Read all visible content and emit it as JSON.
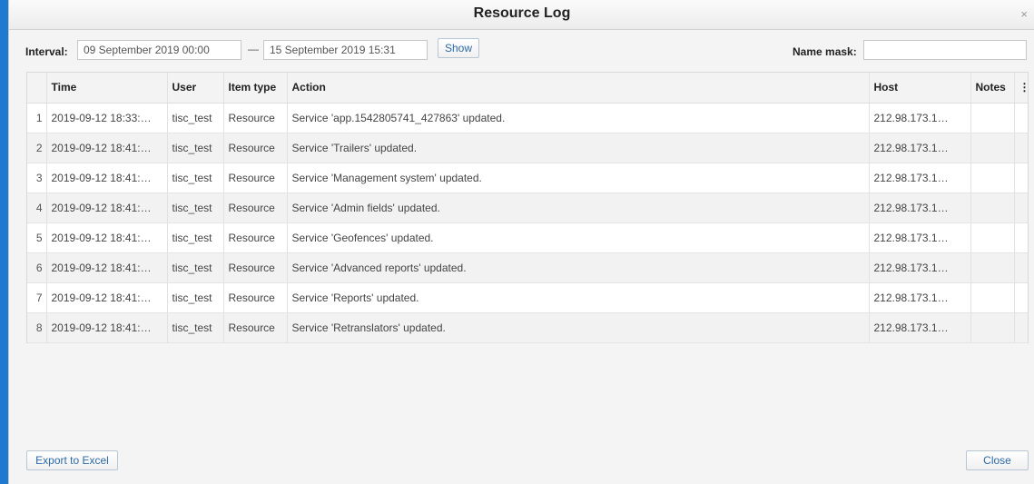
{
  "dialog": {
    "title": "Resource Log",
    "close_icon": "close-icon",
    "close_glyph": "×"
  },
  "filter": {
    "interval_label": "Interval:",
    "from_value": "09 September 2019 00:00",
    "separator": "—",
    "to_value": "15 September 2019 15:31",
    "show_label": "Show",
    "name_mask_label": "Name mask:",
    "name_mask_value": ""
  },
  "table": {
    "columns": {
      "time": "Time",
      "user": "User",
      "item_type": "Item type",
      "action": "Action",
      "host": "Host",
      "notes": "Notes",
      "menu_glyph": "⋮"
    },
    "rows": [
      {
        "num": "1",
        "time": "2019-09-12 18:33:…",
        "user": "tisc_test",
        "item_type": "Resource",
        "action": "Service 'app.1542805741_427863' updated.",
        "host": "212.98.173.1…",
        "notes": ""
      },
      {
        "num": "2",
        "time": "2019-09-12 18:41:…",
        "user": "tisc_test",
        "item_type": "Resource",
        "action": "Service 'Trailers' updated.",
        "host": "212.98.173.1…",
        "notes": ""
      },
      {
        "num": "3",
        "time": "2019-09-12 18:41:…",
        "user": "tisc_test",
        "item_type": "Resource",
        "action": "Service 'Management system' updated.",
        "host": "212.98.173.1…",
        "notes": ""
      },
      {
        "num": "4",
        "time": "2019-09-12 18:41:…",
        "user": "tisc_test",
        "item_type": "Resource",
        "action": "Service 'Admin fields' updated.",
        "host": "212.98.173.1…",
        "notes": ""
      },
      {
        "num": "5",
        "time": "2019-09-12 18:41:…",
        "user": "tisc_test",
        "item_type": "Resource",
        "action": "Service 'Geofences' updated.",
        "host": "212.98.173.1…",
        "notes": ""
      },
      {
        "num": "6",
        "time": "2019-09-12 18:41:…",
        "user": "tisc_test",
        "item_type": "Resource",
        "action": "Service 'Advanced reports' updated.",
        "host": "212.98.173.1…",
        "notes": ""
      },
      {
        "num": "7",
        "time": "2019-09-12 18:41:…",
        "user": "tisc_test",
        "item_type": "Resource",
        "action": "Service 'Reports' updated.",
        "host": "212.98.173.1…",
        "notes": ""
      },
      {
        "num": "8",
        "time": "2019-09-12 18:41:…",
        "user": "tisc_test",
        "item_type": "Resource",
        "action": "Service 'Retranslators' updated.",
        "host": "212.98.173.1…",
        "notes": ""
      }
    ]
  },
  "footer": {
    "export_label": "Export to Excel",
    "close_label": "Close"
  }
}
